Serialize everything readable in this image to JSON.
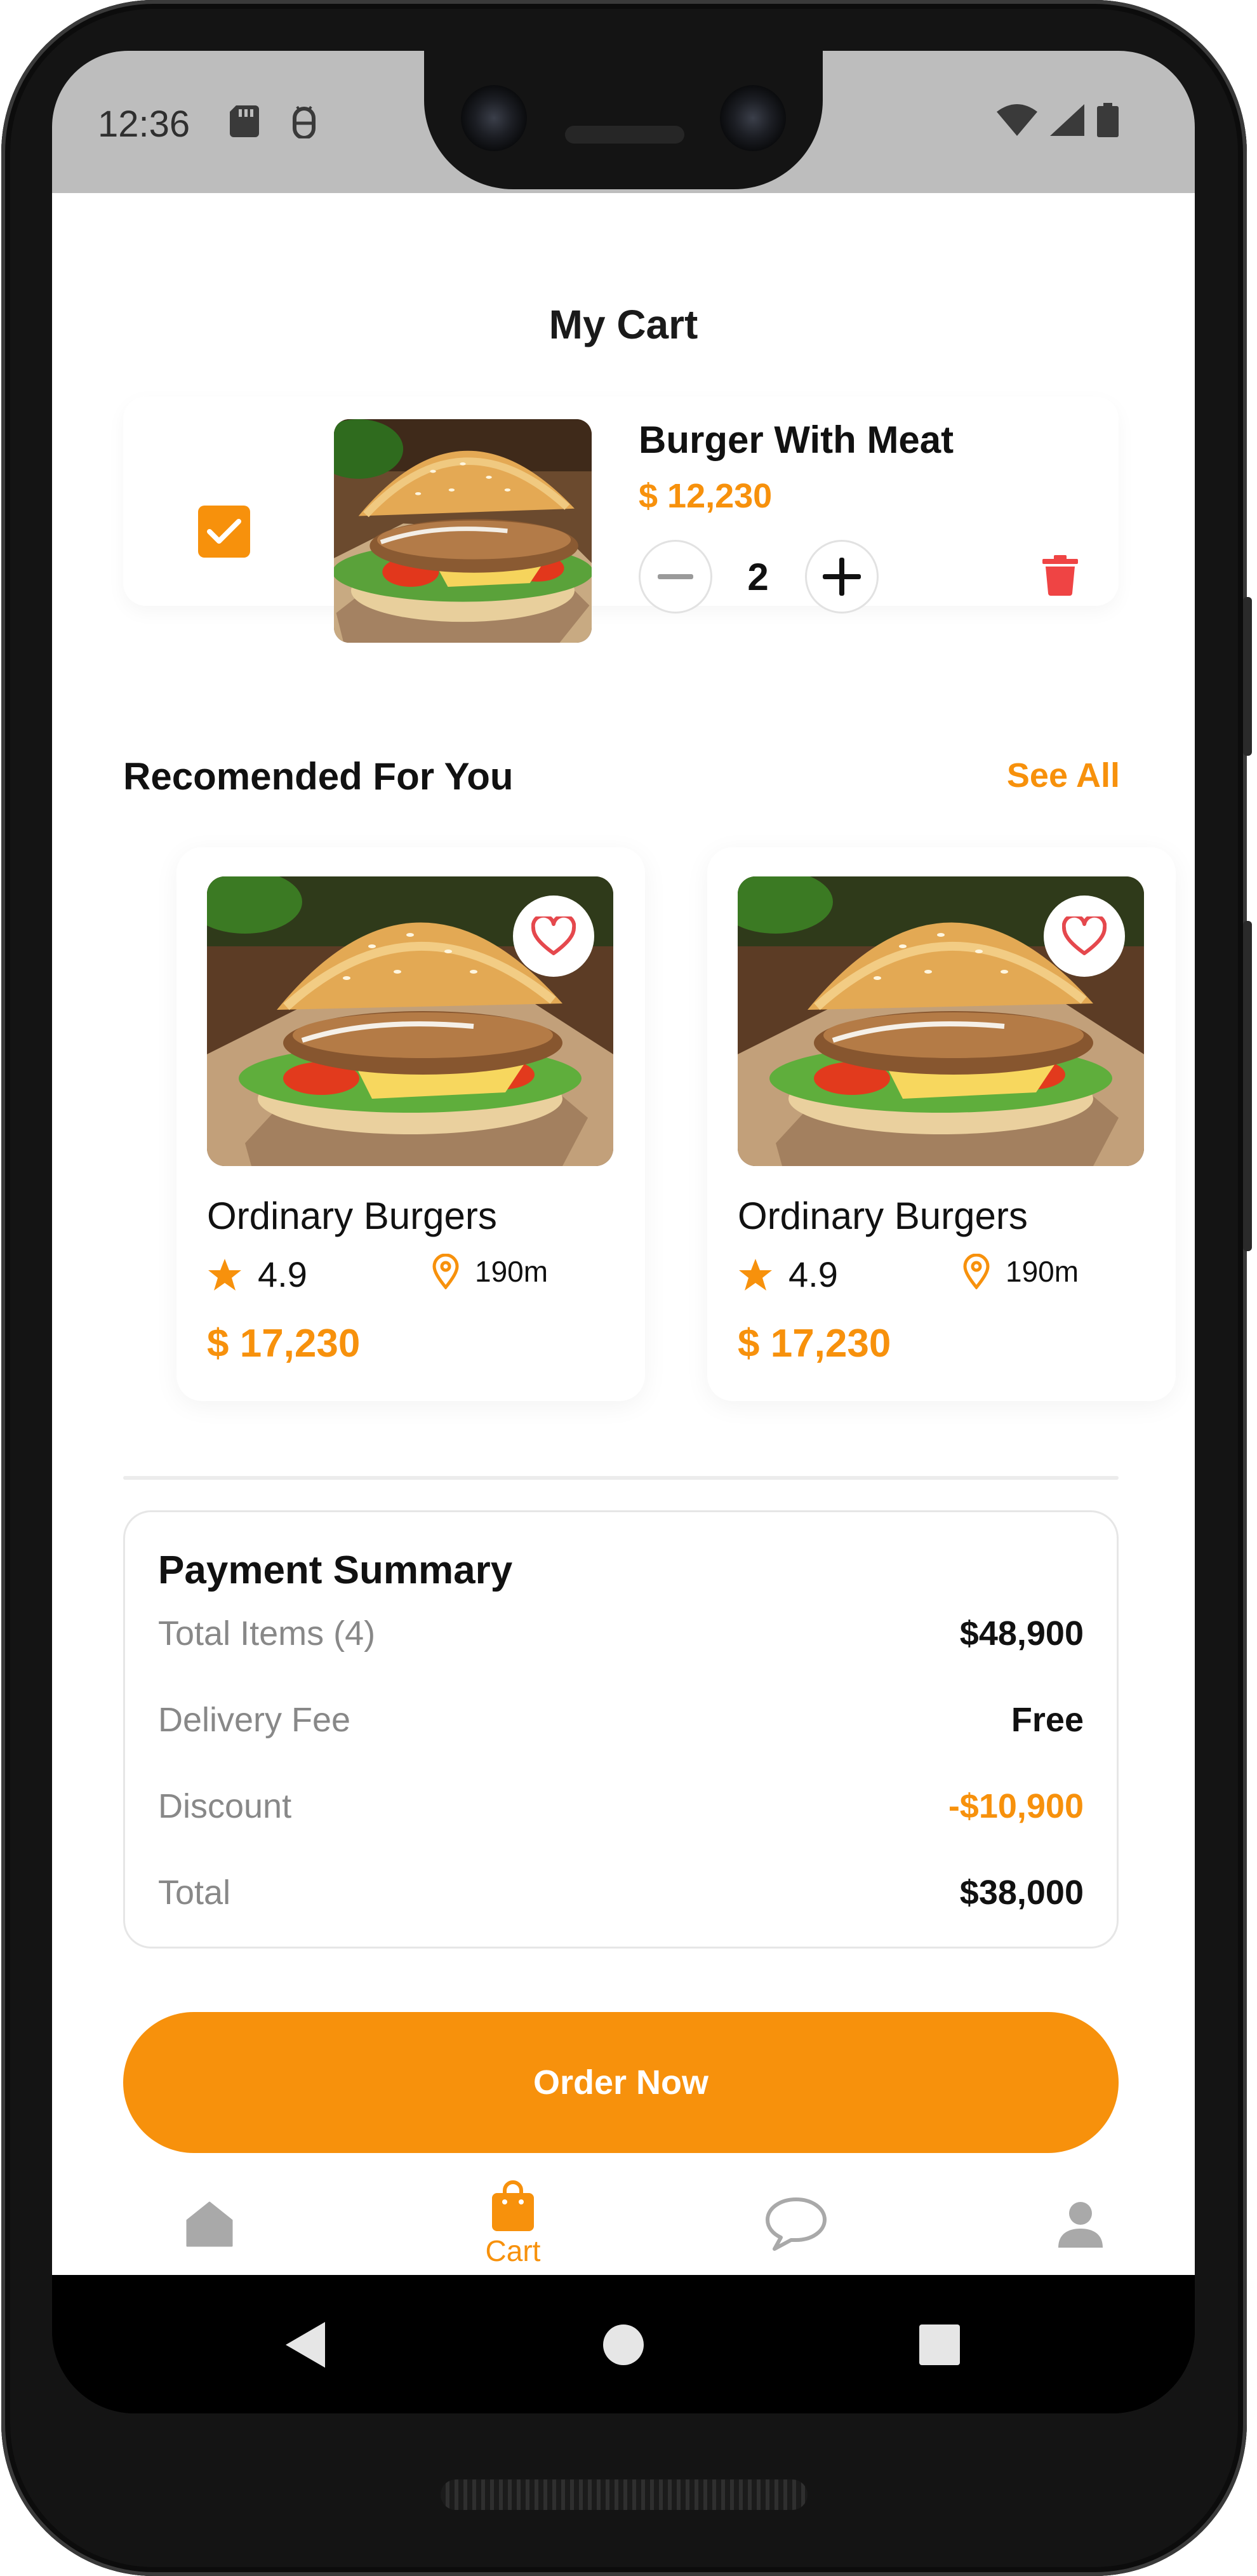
{
  "status_bar": {
    "time": "12:36"
  },
  "app": {
    "title": "My Cart",
    "cart_item": {
      "name": "Burger With Meat",
      "price": "$ 12,230",
      "quantity": "2",
      "checked": true
    },
    "recommended": {
      "title": "Recomended For You",
      "see_all": "See All",
      "items": [
        {
          "name": "Ordinary Burgers",
          "rating": "4.9",
          "distance": "190m",
          "price": "$ 17,230"
        },
        {
          "name": "Ordinary Burgers",
          "rating": "4.9",
          "distance": "190m",
          "price": "$ 17,230"
        }
      ]
    },
    "payment_summary": {
      "title": "Payment Summary",
      "rows": [
        {
          "label": "Total Items (4)",
          "value": "$48,900"
        },
        {
          "label": "Delivery Fee",
          "value": "Free"
        },
        {
          "label": "Discount",
          "value": "-$10,900"
        },
        {
          "label": "Total",
          "value": "$38,000"
        }
      ]
    },
    "order_button": "Order Now",
    "tabs": [
      {
        "icon": "home-icon",
        "label": ""
      },
      {
        "icon": "shopping-bag-icon",
        "label": "Cart",
        "active": true
      },
      {
        "icon": "chat-bubble-icon",
        "label": ""
      },
      {
        "icon": "person-icon",
        "label": ""
      }
    ]
  },
  "colors": {
    "accent": "#f7910c",
    "danger": "#ef4444",
    "muted": "#888888"
  }
}
